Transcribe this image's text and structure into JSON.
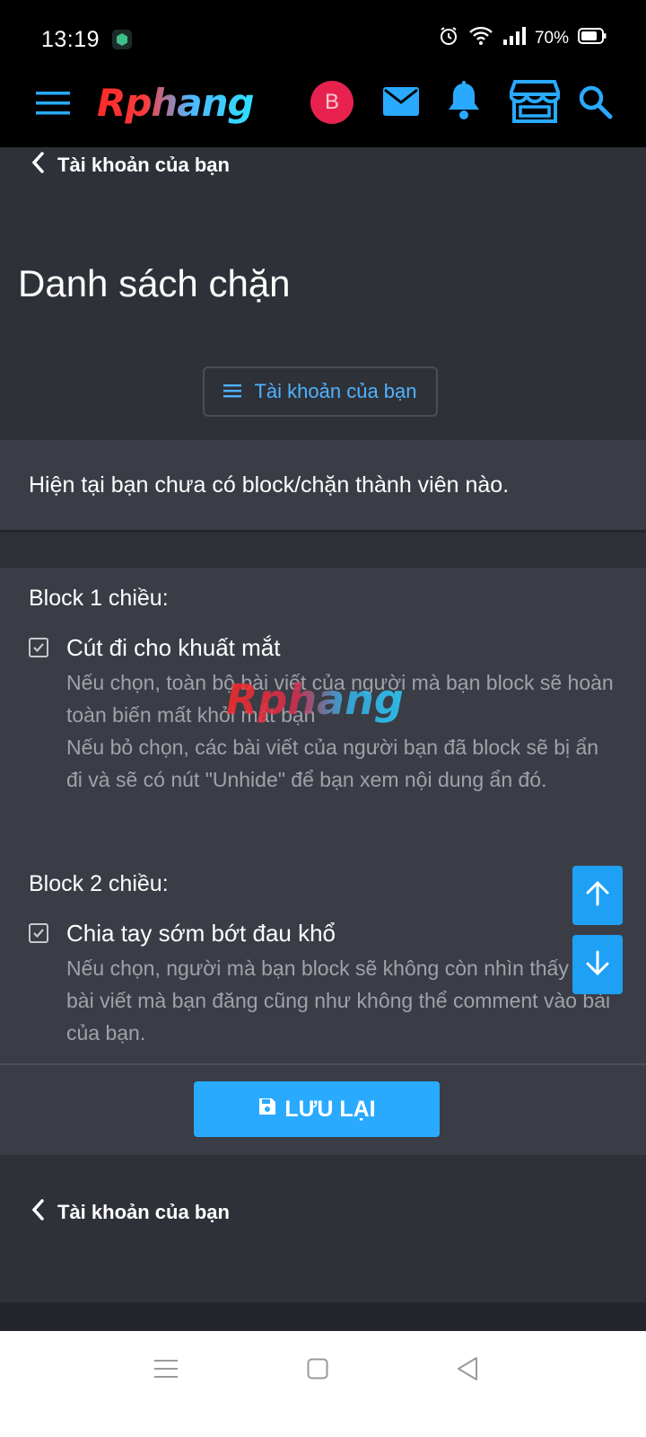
{
  "status": {
    "time": "13:19",
    "battery": "70%"
  },
  "header": {
    "logo_text": "Rphang",
    "avatar_letter": "B"
  },
  "back_top": {
    "label": "Tài khoản của bạn"
  },
  "page": {
    "title": "Danh sách chặn",
    "nav_button": "Tài khoản của bạn",
    "notice": "Hiện tại bạn chưa có block/chặn thành viên nào."
  },
  "options": {
    "block1": {
      "heading": "Block 1 chiều:",
      "label": "Cút đi cho khuất mắt",
      "checked": true,
      "desc_line1": "Nếu chọn, toàn bộ bài viết của người mà bạn block sẽ hoàn toàn biến mất khỏi mắt bạn",
      "desc_line2": "Nếu bỏ chọn, các bài viết của người bạn đã block sẽ bị ẩn đi và sẽ có nút \"Unhide\" để bạn xem nội dung ẩn đó."
    },
    "block2": {
      "heading": "Block 2 chiều:",
      "label": "Chia tay sớm bớt đau khổ",
      "checked": true,
      "desc": "Nếu chọn, người mà bạn block sẽ không còn nhìn thấy các bài viết mà bạn đăng cũng như không thể comment vào bài của bạn."
    }
  },
  "save": {
    "label": "LƯU LẠI"
  },
  "back_bottom": {
    "label": "Tài khoản của bạn"
  },
  "watermark": "Rphang",
  "colors": {
    "accent": "#29aaff",
    "avatar": "#e8224f",
    "background": "#2e3138",
    "panel": "#3a3d45"
  }
}
